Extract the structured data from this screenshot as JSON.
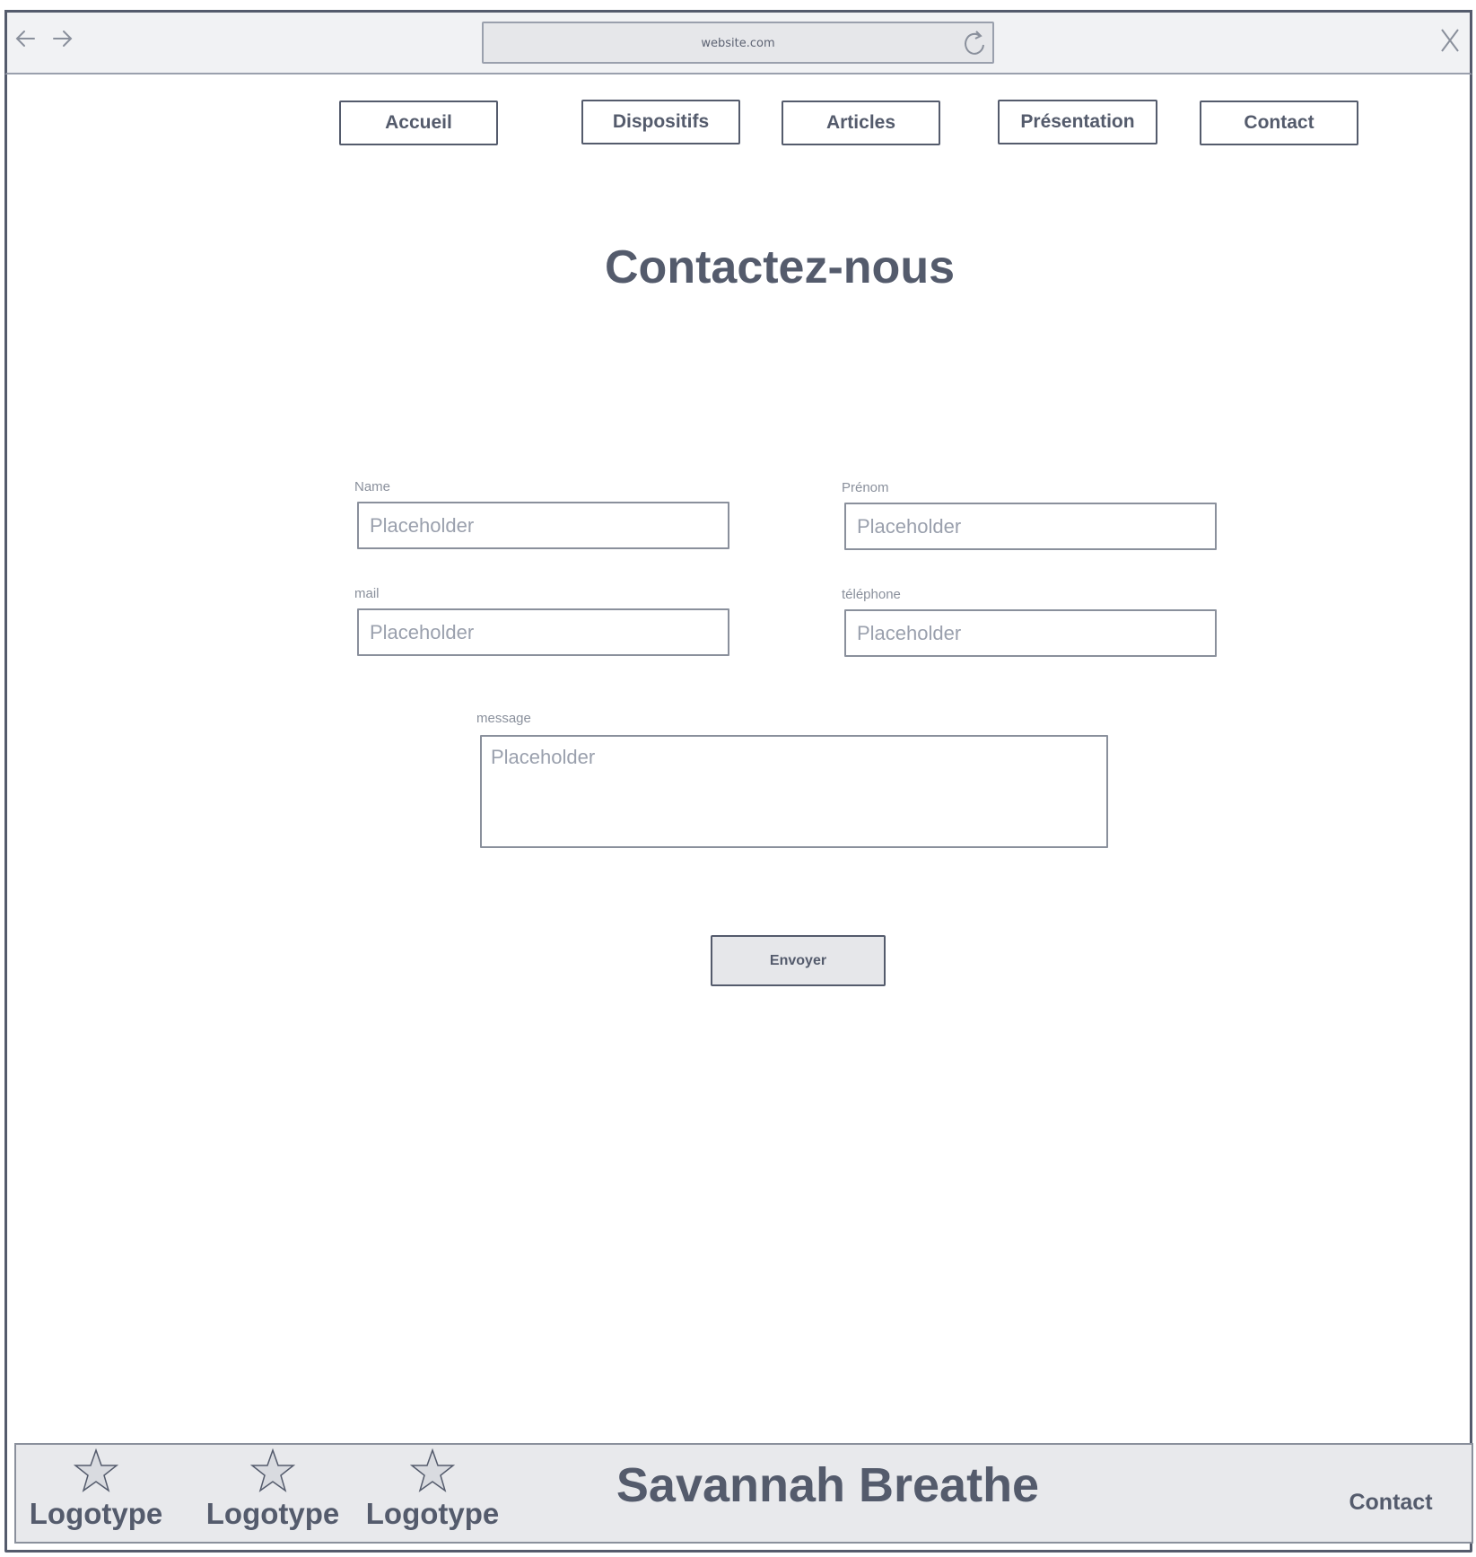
{
  "browser": {
    "url": "website.com"
  },
  "nav": {
    "items": [
      {
        "label": "Accueil"
      },
      {
        "label": "Dispositifs"
      },
      {
        "label": "Articles"
      },
      {
        "label": "Présentation"
      },
      {
        "label": "Contact"
      }
    ]
  },
  "page": {
    "title": "Contactez-nous"
  },
  "form": {
    "name": {
      "label": "Name",
      "placeholder": "Placeholder"
    },
    "prenom": {
      "label": "Prénom",
      "placeholder": "Placeholder"
    },
    "mail": {
      "label": "mail",
      "placeholder": "Placeholder"
    },
    "telephone": {
      "label": "téléphone",
      "placeholder": "Placeholder"
    },
    "message": {
      "label": "message",
      "placeholder": "Placeholder"
    },
    "submit_label": "Envoyer"
  },
  "footer": {
    "logos": [
      {
        "label": "Logotype",
        "icon": "star-icon"
      },
      {
        "label": "Logotype",
        "icon": "star-icon"
      },
      {
        "label": "Logotype",
        "icon": "star-icon"
      }
    ],
    "brand": "Savannah Breathe",
    "contact_label": "Contact"
  },
  "colors": {
    "ink": "#545b6c",
    "muted": "#8a909c",
    "chrome_bg": "#f1f2f4",
    "footer_bg": "#e8e9ec"
  }
}
